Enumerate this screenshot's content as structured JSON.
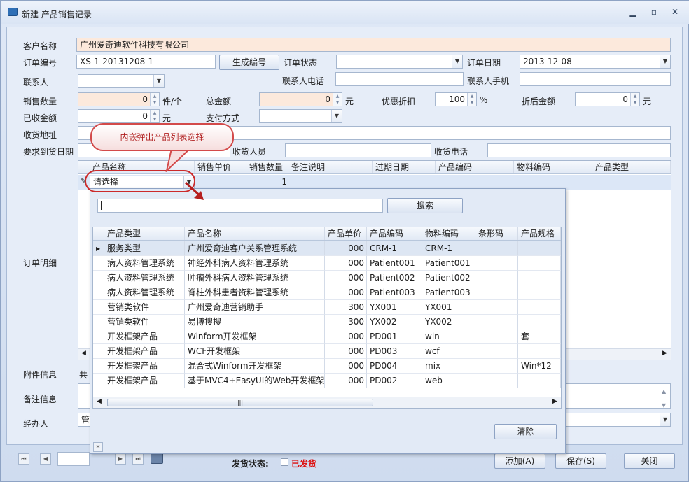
{
  "window": {
    "title": "新建 产品销售记录"
  },
  "form": {
    "customer_label": "客户名称",
    "customer_value": "广州爱奇迪软件科技有限公司",
    "order_no_label": "订单编号",
    "order_no_value": "XS-1-20131208-1",
    "gen_no_button": "生成编号",
    "order_status_label": "订单状态",
    "order_date_label": "订单日期",
    "order_date_value": "2013-12-08",
    "contact_label": "联系人",
    "contact_phone_label": "联系人电话",
    "contact_mobile_label": "联系人手机",
    "sales_qty_label": "销售数量",
    "sales_qty_value": "0",
    "sales_qty_unit": "件/个",
    "total_label": "总金额",
    "total_value": "0",
    "total_unit": "元",
    "discount_label": "优惠折扣",
    "discount_value": "100",
    "discount_unit": "%",
    "after_discount_label": "折后金额",
    "after_discount_value": "0",
    "after_discount_unit": "元",
    "received_label": "已收金额",
    "received_value": "0",
    "received_unit": "元",
    "payment_label": "支付方式",
    "address_label": "收货地址",
    "delivery_date_label": "要求到货日期",
    "receiver_label": "收货人员",
    "receiver_phone_label": "收货电话",
    "detail_label": "订单明细",
    "attach_label": "附件信息",
    "attach_value": "共",
    "remark_label": "备注信息",
    "handler_label": "经办人",
    "handler_value": "管"
  },
  "detail_grid": {
    "columns": [
      "产品名称",
      "销售单价",
      "销售数量",
      "备注说明",
      "过期日期",
      "产品编码",
      "物料编码",
      "产品类型"
    ],
    "row": {
      "product": "请选择",
      "qty": "1"
    }
  },
  "callout": {
    "text": "内嵌弹出产品列表选择"
  },
  "popup": {
    "search_button": "搜索",
    "clear_button": "清除",
    "columns": [
      "产品类型",
      "产品名称",
      "产品单价",
      "产品编码",
      "物料编码",
      "条形码",
      "产品规格"
    ],
    "rows": [
      {
        "type": "服务类型",
        "name": "广州爱奇迪客户关系管理系统",
        "price": "000",
        "code": "CRM-1",
        "mat": "CRM-1",
        "bar": "",
        "spec": ""
      },
      {
        "type": "病人资料管理系统",
        "name": "神经外科病人资料管理系统",
        "price": "000",
        "code": "Patient001",
        "mat": "Patient001",
        "bar": "",
        "spec": ""
      },
      {
        "type": "病人资料管理系统",
        "name": "肿瘤外科病人资料管理系统",
        "price": "000",
        "code": "Patient002",
        "mat": "Patient002",
        "bar": "",
        "spec": ""
      },
      {
        "type": "病人资料管理系统",
        "name": "脊柱外科患者资料管理系统",
        "price": "000",
        "code": "Patient003",
        "mat": "Patient003",
        "bar": "",
        "spec": ""
      },
      {
        "type": "营销类软件",
        "name": "广州爱奇迪营销助手",
        "price": "300",
        "code": "YX001",
        "mat": "YX001",
        "bar": "",
        "spec": ""
      },
      {
        "type": "营销类软件",
        "name": "易博搜搜",
        "price": "300",
        "code": "YX002",
        "mat": "YX002",
        "bar": "",
        "spec": ""
      },
      {
        "type": "开发框架产品",
        "name": "Winform开发框架",
        "price": "000",
        "code": "PD001",
        "mat": "win",
        "bar": "",
        "spec": "套"
      },
      {
        "type": "开发框架产品",
        "name": "WCF开发框架",
        "price": "000",
        "code": "PD003",
        "mat": "wcf",
        "bar": "",
        "spec": ""
      },
      {
        "type": "开发框架产品",
        "name": "混合式Winform开发框架",
        "price": "000",
        "code": "PD004",
        "mat": "mix",
        "bar": "",
        "spec": "Win*12"
      },
      {
        "type": "开发框架产品",
        "name": "基于MVC4+EasyUI的Web开发框架",
        "price": "000",
        "code": "PD002",
        "mat": "web",
        "bar": "",
        "spec": ""
      }
    ]
  },
  "footer": {
    "ship_status_label": "发货状态:",
    "shipped_label": "已发货",
    "add_button": "添加(A)",
    "save_button": "保存(S)",
    "close_button": "关闭"
  }
}
